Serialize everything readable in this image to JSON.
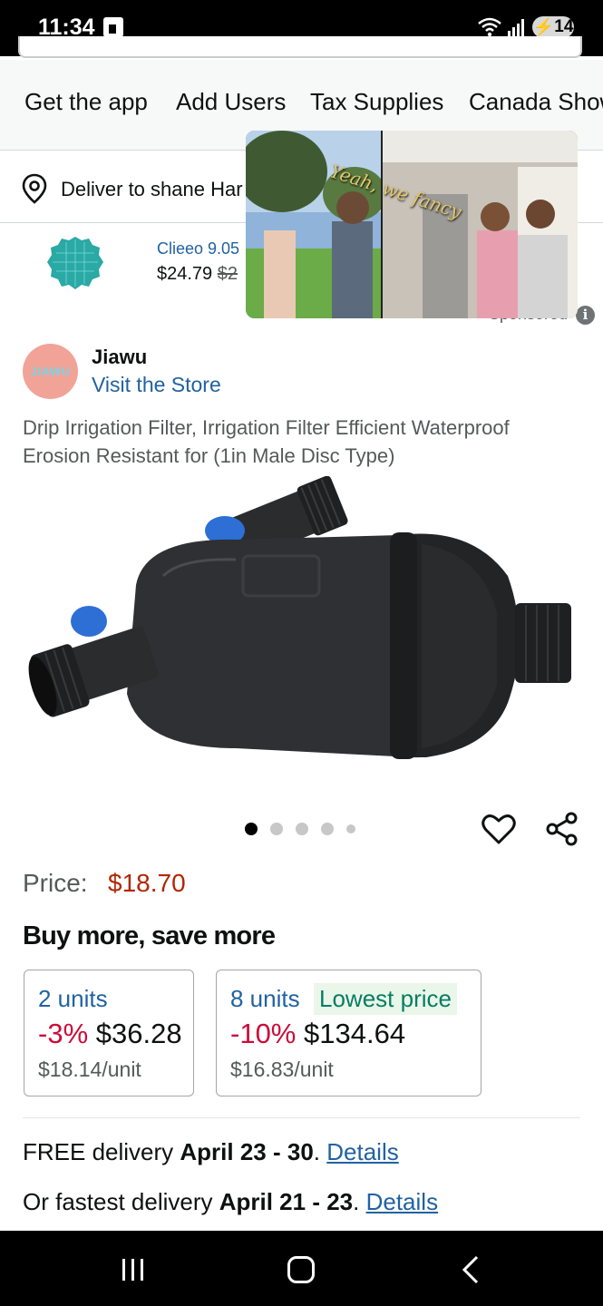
{
  "status_bar": {
    "time": "11:34",
    "battery": "14"
  },
  "top_nav": {
    "items": [
      "Get the app",
      "Add Users",
      "Tax Supplies",
      "Canada Show"
    ]
  },
  "delivery": {
    "label": "Deliver to shane Har"
  },
  "sponsored": {
    "title": "Clieeo 9.05",
    "price": "$24.79",
    "old_price": "$2",
    "label": "Sponsored"
  },
  "video_caption": "Yeah, we fancy",
  "store": {
    "logo_text": "JIAWU",
    "name": "Jiawu",
    "link": "Visit the Store"
  },
  "product": {
    "title": "Drip Irrigation Filter, Irrigation Filter Efficient Waterproof Erosion Resistant for (1in Male Disc Type)",
    "image_count": 5,
    "active_image": 1
  },
  "price": {
    "label": "Price:",
    "value": "$18.70"
  },
  "buy_more": {
    "heading": "Buy more, save more",
    "options": [
      {
        "units": "2 units",
        "discount": "-3%",
        "total": "$36.28",
        "per_unit": "$18.14/unit",
        "badge": ""
      },
      {
        "units": "8 units",
        "discount": "-10%",
        "total": "$134.64",
        "per_unit": "$16.83/unit",
        "badge": "Lowest price"
      }
    ]
  },
  "delivery_info": {
    "free_prefix": "FREE delivery ",
    "free_dates": "April 23 - 30",
    "free_sep": ". ",
    "free_link": "Details",
    "fast_prefix": "Or fastest delivery ",
    "fast_dates": "April 21 - 23",
    "fast_sep": ". ",
    "fast_link": "Details"
  },
  "colors": {
    "price_red": "#b12704",
    "discount_red": "#cc0c39",
    "link_blue": "#2162a1",
    "deal_green": "#067d62"
  }
}
